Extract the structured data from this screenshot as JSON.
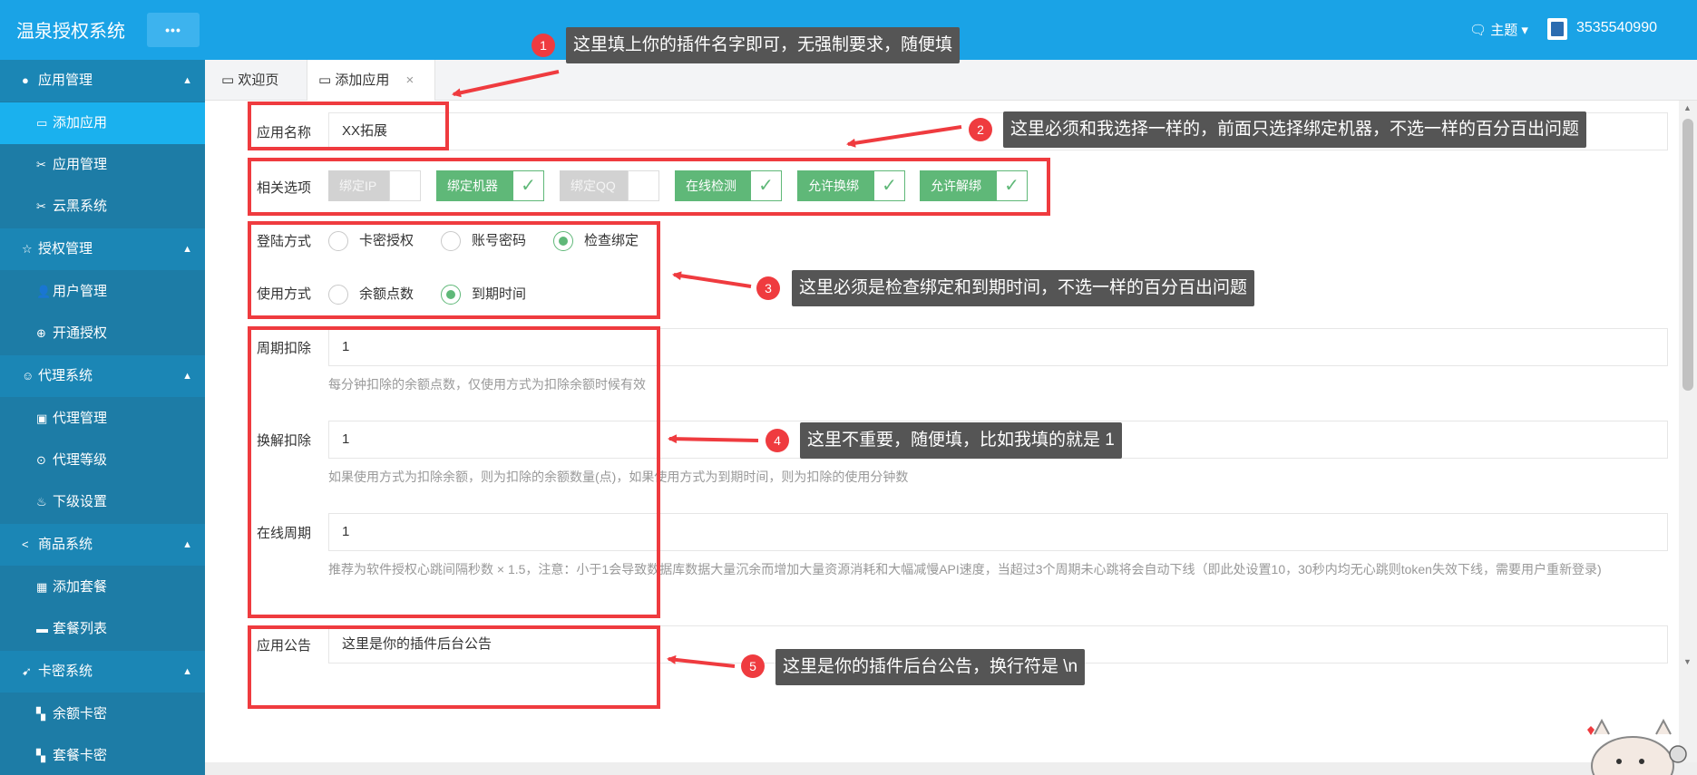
{
  "header": {
    "brand": "温泉授权系统",
    "menu_dots": "•••",
    "theme": "🗨 主题 ▾",
    "user_id": "3535540990"
  },
  "sidebar": {
    "groups": [
      {
        "label": "应用管理",
        "icon": "●"
      },
      {
        "label": "授权管理",
        "icon": "☆"
      },
      {
        "label": "代理系统",
        "icon": "☺"
      },
      {
        "label": "商品系统",
        "icon": "<"
      },
      {
        "label": "卡密系统",
        "icon": "➹"
      }
    ],
    "items": [
      {
        "label": "添加应用",
        "icon": "▭"
      },
      {
        "label": "应用管理",
        "icon": "✂"
      },
      {
        "label": "云黑系统",
        "icon": "✂"
      },
      {
        "label": "用户管理",
        "icon": "👤"
      },
      {
        "label": "开通授权",
        "icon": "⊕"
      },
      {
        "label": "代理管理",
        "icon": "▣"
      },
      {
        "label": "代理等级",
        "icon": "⊙"
      },
      {
        "label": "下级设置",
        "icon": "♨"
      },
      {
        "label": "添加套餐",
        "icon": "▦"
      },
      {
        "label": "套餐列表",
        "icon": "▬"
      },
      {
        "label": "余额卡密",
        "icon": "▚"
      },
      {
        "label": "套餐卡密",
        "icon": "▚"
      }
    ]
  },
  "tabs": [
    {
      "label": "欢迎页",
      "icon": "▭"
    },
    {
      "label": "添加应用",
      "icon": "▭",
      "close": "×"
    }
  ],
  "form": {
    "app_name": {
      "label": "应用名称",
      "value": "XX拓展"
    },
    "options": {
      "label": "相关选项",
      "toggles": [
        {
          "label": "绑定IP",
          "on": false
        },
        {
          "label": "绑定机器",
          "on": true
        },
        {
          "label": "绑定QQ",
          "on": false
        },
        {
          "label": "在线检测",
          "on": true
        },
        {
          "label": "允许换绑",
          "on": true
        },
        {
          "label": "允许解绑",
          "on": true
        }
      ],
      "check": "✓"
    },
    "login_method": {
      "label": "登陆方式",
      "options": [
        "卡密授权",
        "账号密码",
        "检查绑定"
      ]
    },
    "use_method": {
      "label": "使用方式",
      "options": [
        "余额点数",
        "到期时间"
      ]
    },
    "cycle_deduct": {
      "label": "周期扣除",
      "value": "1",
      "hint": "每分钟扣除的余额点数，仅使用方式为扣除余额时候有效"
    },
    "unbind_deduct": {
      "label": "换解扣除",
      "value": "1",
      "hint": "如果使用方式为扣除余额，则为扣除的余额数量(点)，如果使用方式为到期时间，则为扣除的使用分钟数"
    },
    "online_cycle": {
      "label": "在线周期",
      "value": "1",
      "hint": "推荐为软件授权心跳间隔秒数 × 1.5，注意：小于1会导致数据库数据大量沉余而增加大量资源消耗和大幅减慢API速度，当超过3个周期未心跳将会自动下线（即此处设置10，30秒内均无心跳则token失效下线，需要用户重新登录)"
    },
    "notice": {
      "label": "应用公告",
      "value": "这里是你的插件后台公告"
    }
  },
  "annotations": [
    {
      "num": "1",
      "text": "这里填上你的插件名字即可，无强制要求，随便填"
    },
    {
      "num": "2",
      "text": "这里必须和我选择一样的，前面只选择绑定机器，不选一样的百分百出问题"
    },
    {
      "num": "3",
      "text": "这里必须是检查绑定和到期时间，不选一样的百分百出问题"
    },
    {
      "num": "4",
      "text": "这里不重要，随便填，比如我填的就是  1"
    },
    {
      "num": "5",
      "text": "这里是你的插件后台公告，换行符是 \\n"
    }
  ],
  "colors": {
    "header": "#1aa3e6",
    "sidebar": "#1d7ca6",
    "sidebar_active": "#1ab1ee",
    "toggle_on": "#5fb878",
    "highlight": "#ef3b3f",
    "note_bg": "#555555"
  }
}
